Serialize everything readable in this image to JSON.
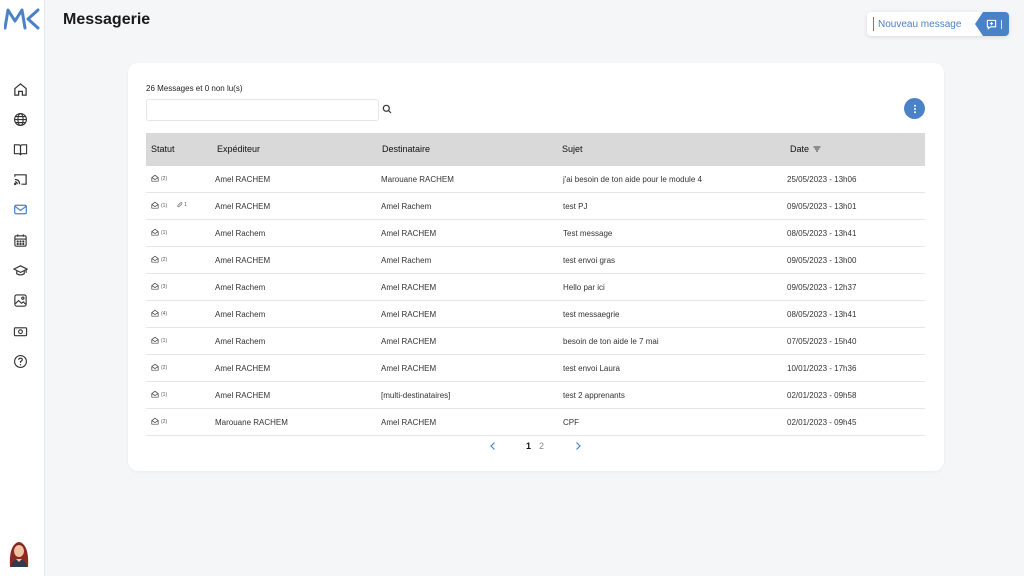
{
  "page": {
    "title": "Messagerie"
  },
  "header": {
    "new_message_label": "Nouveau message"
  },
  "inbox": {
    "summary": "26 Messages et 0 non lu(s)",
    "search_placeholder": "",
    "columns": [
      "Statut",
      "Expéditeur",
      "Destinataire",
      "Sujet",
      "Date"
    ],
    "sort_column": "Date",
    "rows": [
      {
        "count": "(2)",
        "attachments": "",
        "from": "Amel RACHEM",
        "to": "Marouane RACHEM",
        "subject": "j'ai besoin de ton aide pour le module 4",
        "date": "25/05/2023 - 13h06"
      },
      {
        "count": "(1)",
        "attachments": "1",
        "from": "Amel RACHEM",
        "to": "Amel Rachem",
        "subject": "test PJ",
        "date": "09/05/2023 - 13h01"
      },
      {
        "count": "(1)",
        "attachments": "",
        "from": "Amel Rachem",
        "to": "Amel RACHEM",
        "subject": "Test message",
        "date": "08/05/2023 - 13h41"
      },
      {
        "count": "(2)",
        "attachments": "",
        "from": "Amel RACHEM",
        "to": "Amel Rachem",
        "subject": "test envoi gras",
        "date": "09/05/2023 - 13h00"
      },
      {
        "count": "(3)",
        "attachments": "",
        "from": "Amel Rachem",
        "to": "Amel RACHEM",
        "subject": "Hello par ici",
        "date": "09/05/2023 - 12h37"
      },
      {
        "count": "(4)",
        "attachments": "",
        "from": "Amel Rachem",
        "to": "Amel RACHEM",
        "subject": "test messaegrie",
        "date": "08/05/2023 - 13h41"
      },
      {
        "count": "(1)",
        "attachments": "",
        "from": "Amel Rachem",
        "to": "Amel RACHEM",
        "subject": "besoin de ton aide le 7 mai",
        "date": "07/05/2023 - 15h40"
      },
      {
        "count": "(2)",
        "attachments": "",
        "from": "Amel RACHEM",
        "to": "Amel RACHEM",
        "subject": "test envoi Laura",
        "date": "10/01/2023 - 17h36"
      },
      {
        "count": "(1)",
        "attachments": "",
        "from": "Amel RACHEM",
        "to": "[multi-destinataires]",
        "subject": "test 2 apprenants",
        "date": "02/01/2023 - 09h58"
      },
      {
        "count": "(2)",
        "attachments": "",
        "from": "Marouane RACHEM",
        "to": "Amel RACHEM",
        "subject": "CPF",
        "date": "02/01/2023 - 09h45"
      }
    ]
  },
  "pagination": {
    "pages": [
      "1",
      "2"
    ],
    "current": "1"
  },
  "sidebar": {
    "items": [
      {
        "icon": "home-icon"
      },
      {
        "icon": "globe-icon"
      },
      {
        "icon": "book-icon"
      },
      {
        "icon": "cast-icon"
      },
      {
        "icon": "mail-icon",
        "active": true
      },
      {
        "icon": "calendar-icon"
      },
      {
        "icon": "graduation-cap-icon"
      },
      {
        "icon": "image-icon"
      },
      {
        "icon": "money-icon"
      },
      {
        "icon": "help-icon"
      }
    ]
  },
  "colors": {
    "accent": "#4a82c8",
    "header_bg": "#d9d9d9",
    "page_bg": "#f5f6f8"
  }
}
